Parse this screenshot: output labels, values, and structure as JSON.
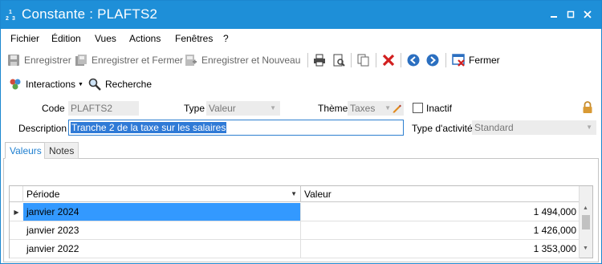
{
  "window": {
    "title": "Constante : PLAFTS2",
    "icon_name": "constant-icon",
    "controls": [
      "minimize-icon",
      "maximize-icon",
      "close-icon"
    ]
  },
  "menu": {
    "items": [
      "Fichier",
      "Édition",
      "Vues",
      "Actions",
      "Fenêtres",
      "?"
    ]
  },
  "toolbar": {
    "save_label": "Enregistrer",
    "save_close_label": "Enregistrer et Fermer",
    "save_new_label": "Enregistrer et Nouveau",
    "close_label": "Fermer"
  },
  "toolbar2": {
    "interactions_label": "Interactions",
    "search_label": "Recherche"
  },
  "form": {
    "code_label": "Code",
    "code_value": "PLAFTS2",
    "type_label": "Type",
    "type_value": "Valeur",
    "theme_label": "Thème",
    "theme_value": "Taxes",
    "inactive_label": "Inactif",
    "description_label": "Description",
    "description_value": "Tranche 2 de la taxe sur les salaires",
    "activity_label": "Type d'activité",
    "activity_value": "Standard"
  },
  "tabs": [
    "Valeurs",
    "Notes"
  ],
  "grid": {
    "columns": [
      "Période",
      "Valeur"
    ],
    "rows": [
      {
        "period": "janvier 2024",
        "value": "1 494,000"
      },
      {
        "period": "janvier 2023",
        "value": "1 426,000"
      },
      {
        "period": "janvier 2022",
        "value": "1 353,000"
      }
    ]
  },
  "colors": {
    "titlebar": "#1e8fd8",
    "selection": "#2f7ad6",
    "selected_cell": "#3399ff"
  }
}
